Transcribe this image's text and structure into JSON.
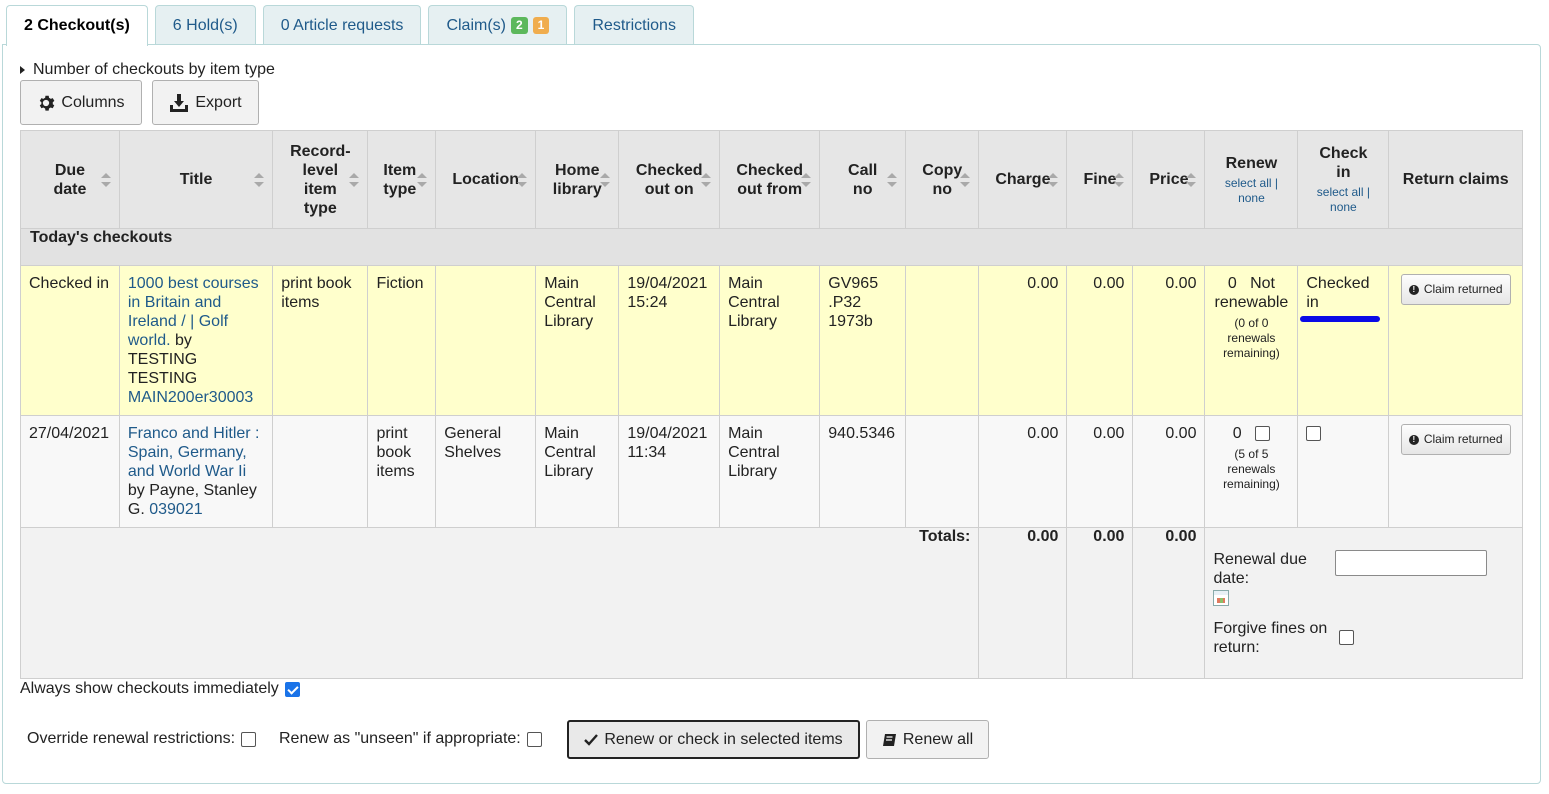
{
  "tabs": [
    {
      "label": "2 Checkout(s)"
    },
    {
      "label": "6 Hold(s)"
    },
    {
      "label": "0 Article requests"
    },
    {
      "label": "Claim(s)",
      "badges": [
        "2",
        "1"
      ]
    },
    {
      "label": "Restrictions"
    }
  ],
  "toggle_label": "Number of checkouts by item type",
  "toolbar": {
    "columns_label": "Columns",
    "export_label": "Export"
  },
  "headers": {
    "due_date": "Due date",
    "title": "Title",
    "record_level_item_type": "Record-level item type",
    "item_type": "Item type",
    "location": "Location",
    "home_library": "Home library",
    "checked_out_on": "Checked out on",
    "checked_out_from": "Checked out from",
    "call_no": "Call no",
    "copy_no": "Copy no",
    "charge": "Charge",
    "fine": "Fine",
    "price": "Price",
    "renew": "Renew",
    "check_in": "Check in",
    "select_all": "select all",
    "sep": "|",
    "none": "none",
    "return_claims": "Return claims"
  },
  "group_label": "Today's checkouts",
  "rows": [
    {
      "due": "Checked in",
      "title_link": "1000 best courses in Britain and Ireland / | Golf world.",
      "by": " by TESTING TESTING",
      "barcode": "MAIN200er30003",
      "record_type": "print book items",
      "item_type": "Fiction",
      "location": "",
      "home_library": "Main Central Library",
      "checked_out_on": "19/04/2021 15:24",
      "checked_out_from": "Main Central Library",
      "call_no": "GV965 .P32 1973b",
      "copy_no": "",
      "charge": "0.00",
      "fine": "0.00",
      "price": "0.00",
      "renew_count": "0",
      "renew_status": "Not renewable",
      "renew_note": "(0 of 0 renewals remaining)",
      "checkin": "Checked in",
      "claim_label": "Claim returned"
    },
    {
      "due": "27/04/2021",
      "title_link": "Franco and Hitler : Spain, Germany, and World War Ii",
      "by": " by Payne, Stanley G.",
      "barcode": "039021",
      "record_type": "",
      "item_type": "print book items",
      "location": "General Shelves",
      "home_library": "Main Central Library",
      "checked_out_on": "19/04/2021 11:34",
      "checked_out_from": "Main Central Library",
      "call_no": "940.5346",
      "copy_no": "",
      "charge": "0.00",
      "fine": "0.00",
      "price": "0.00",
      "renew_count": "0",
      "renew_note": "(5 of 5 renewals remaining)",
      "claim_label": "Claim returned"
    }
  ],
  "totals": {
    "label": "Totals:",
    "charge": "0.00",
    "fine": "0.00",
    "price": "0.00"
  },
  "renewal_due_date_label": "Renewal due date:",
  "forgive_fines_label": "Forgive fines on return:",
  "always_show_label": "Always show checkouts immediately",
  "always_show_checked": true,
  "override_label": "Override renewal restrictions:",
  "unseen_label": "Renew as \"unseen\" if appropriate:",
  "renew_checkin_label": "Renew or check in selected items",
  "renew_all_label": "Renew all"
}
